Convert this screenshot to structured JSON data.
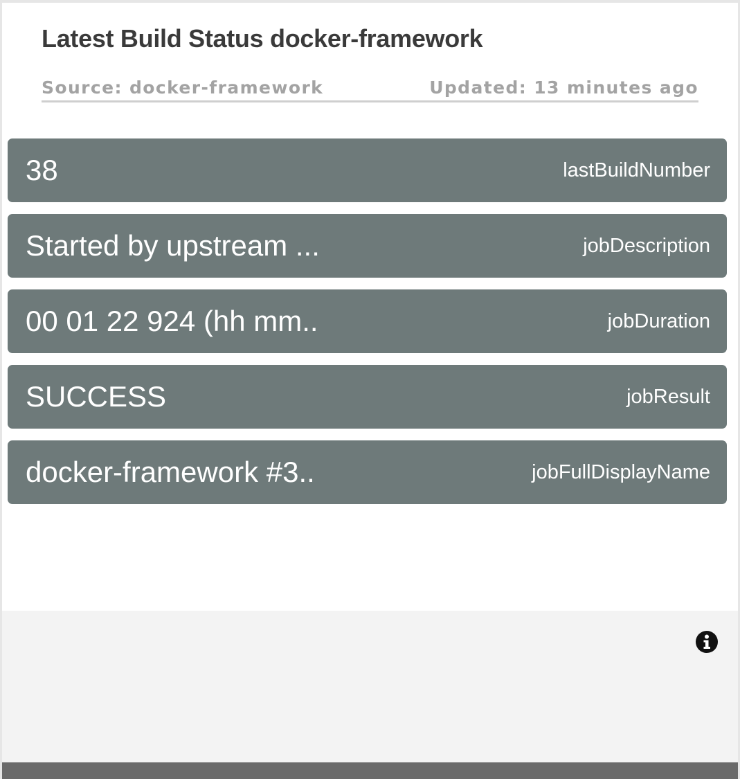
{
  "widget": {
    "title": "Latest Build Status docker-framework",
    "source": "Source: docker-framework",
    "updated": "Updated: 13 minutes ago"
  },
  "rows": [
    {
      "value": "38",
      "key": "lastBuildNumber"
    },
    {
      "value": "Started by upstream ...",
      "key": "jobDescription"
    },
    {
      "value": "00 01 22 924 (hh mm..",
      "key": "jobDuration"
    },
    {
      "value": "SUCCESS",
      "key": "jobResult"
    },
    {
      "value": "docker-framework #3..",
      "key": "jobFullDisplayName"
    }
  ],
  "icons": {
    "info": "info-icon"
  },
  "colors": {
    "row_background": "#6e7a7a",
    "title_text": "#3a3a3a",
    "meta_text": "#a3a3a3",
    "footer_background": "#f3f3f3",
    "bottom_bar": "#6a6a6a"
  }
}
